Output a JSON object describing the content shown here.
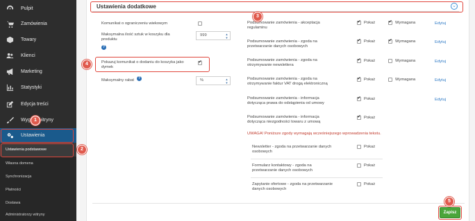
{
  "sidebar": {
    "items": [
      {
        "label": "Pulpit",
        "icon": "dashboard-icon"
      },
      {
        "label": "Zamówienia",
        "icon": "cart-icon"
      },
      {
        "label": "Towary",
        "icon": "box-icon"
      },
      {
        "label": "Klienci",
        "icon": "users-icon"
      },
      {
        "label": "Marketing",
        "icon": "megaphone-icon"
      },
      {
        "label": "Statystyki",
        "icon": "chart-icon"
      },
      {
        "label": "Edycja treści",
        "icon": "edit-icon"
      },
      {
        "label": "Wygląd witryny",
        "icon": "brush-icon"
      },
      {
        "label": "Ustawienia",
        "icon": "gears-icon"
      }
    ],
    "subitems": [
      {
        "label": "Ustawienia podstawowe"
      },
      {
        "label": "Własna domena"
      },
      {
        "label": "Synchronizacja"
      },
      {
        "label": "Płatności"
      },
      {
        "label": "Dostawa"
      },
      {
        "label": "Administratorzy witryny"
      }
    ]
  },
  "section": {
    "title": "Ustawienia dodatkowe"
  },
  "left": {
    "min_age_label": "Komunikat o ograniczeniu wiekowym",
    "max_qty_label": "Maksymalna ilość sztuk w koszyku dla produktu",
    "max_qty_value": "999",
    "popup_label": "Pokazuj komunikat o dodaniu do koszyka jako dymek",
    "max_discount_label": "Maksymalny rabat",
    "max_discount_value": "%"
  },
  "consents": [
    {
      "label": "Podsumowanie zamówienia - akceptacja regulaminu",
      "show": "Pokaż",
      "required": "Wymagana",
      "edit": "Edytuj"
    },
    {
      "label": "Podsumowanie zamówienia - zgoda na przetwarzanie danych osobowych",
      "show": "Pokaż",
      "required": "Wymagana",
      "edit": "Edytuj"
    },
    {
      "label": "Podsumowanie zamówienia - zgoda na otrzymywanie newslettera",
      "show": "Pokaż",
      "required": "Wymagana",
      "edit": "Edytuj"
    },
    {
      "label": "Podsumowanie zamówienia - zgoda na otrzymywanie faktur VAT drogą elektroniczną",
      "show": "Pokaż",
      "required": "Wymagana",
      "edit": "Edytuj"
    },
    {
      "label": "Podsumowanie zamówienia - informacja dotycząca prawa do odstąpienia od umowy",
      "show": "Pokaż",
      "edit": "Edytuj"
    },
    {
      "label": "Podsumowanie zamówienia - informacja dotycząca niezgodności towaru z umową",
      "show": "Pokaż"
    }
  ],
  "warning": "UWAGA! Poniższe zgody wymagają wcześniejszego wprowadzenia tekstu.",
  "extra_consents": [
    {
      "label": "Newsletter - zgoda na przetwarzanie danych osobowych",
      "show": "Pokaż"
    },
    {
      "label": "Formularz kontaktowy - zgoda na przetwarzanie danych osobowych",
      "show": "Pokaż"
    },
    {
      "label": "Zapytanie ofertowe - zgoda na przetwarzanie danych osobowych",
      "show": "Pokaż"
    }
  ],
  "save_label": "Zapisz",
  "callouts": [
    "1",
    "2",
    "3",
    "4",
    "5"
  ],
  "colors": {
    "sidebar": "#2d2d2d",
    "active": "#1a5a8c",
    "annotation": "#e05a4d",
    "save": "#4aa53a",
    "link": "#2b78c5"
  }
}
